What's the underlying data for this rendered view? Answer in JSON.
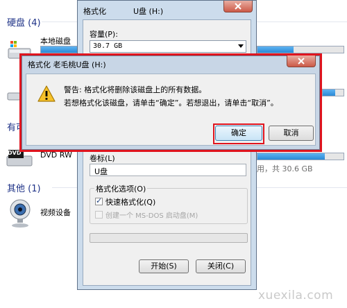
{
  "explorer": {
    "group_harddisk": "硬盘 (4)",
    "local_disk_label": "本地磁盘",
    "group_removable_partial": "有可",
    "dvd_label": "DVD RW",
    "dvd_prefix": "DVD",
    "free_text": "用，共 30.6 GB",
    "group_other": "其他 (1)",
    "video_device_label": "视频设备"
  },
  "format_dialog": {
    "title": "格式化",
    "title_drive": "U盘 (H:)",
    "capacity_label": "容量(P):",
    "capacity_value": "30.7 GB",
    "volume_label": "卷标(L)",
    "volume_value": "U盘",
    "options_label": "格式化选项(O)",
    "quick_format_label": "快速格式化(Q)",
    "quick_format_checked": true,
    "msdos_label": "创建一个 MS-DOS 启动盘(M)",
    "msdos_enabled": false,
    "start_button": "开始(S)",
    "close_button": "关闭(C)"
  },
  "warning_dialog": {
    "title": "格式化 老毛桃U盘 (H:)",
    "message_line1": "警告: 格式化将删除该磁盘上的所有数据。",
    "message_line2": "若想格式化该磁盘，请单击“确定”。若想退出，请单击“取消”。",
    "ok_button": "确定",
    "cancel_button": "取消"
  },
  "watermark": "xuexila.com",
  "colors": {
    "highlight_red": "#e0141e",
    "group_title_blue": "#1e3287",
    "usage_fill": "#2a8ad6"
  }
}
